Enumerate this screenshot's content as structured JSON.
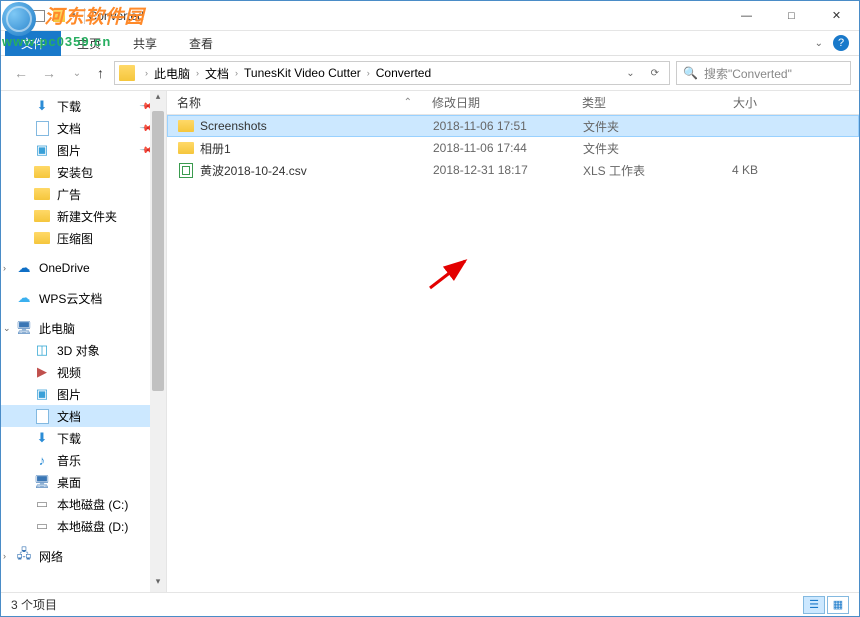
{
  "window": {
    "title": "Converted",
    "minimize": "—",
    "maximize": "□",
    "close": "✕"
  },
  "ribbon": {
    "file": "文件",
    "home": "主页",
    "share": "共享",
    "view": "查看",
    "expand_hint": "⌄"
  },
  "nav": {
    "back": "←",
    "forward": "→",
    "recent": "⌄",
    "up": "↑",
    "refresh": "⟳",
    "search_placeholder": "搜索\"Converted\""
  },
  "breadcrumb": {
    "root": "此电脑",
    "p1": "文档",
    "p2": "TunesKit Video Cutter",
    "p3": "Converted"
  },
  "columns": {
    "name": "名称",
    "date": "修改日期",
    "type": "类型",
    "size": "大小"
  },
  "files": [
    {
      "name": "Screenshots",
      "date": "2018-11-06 17:51",
      "type": "文件夹",
      "size": "",
      "kind": "folder",
      "selected": true
    },
    {
      "name": "相册1",
      "date": "2018-11-06 17:44",
      "type": "文件夹",
      "size": "",
      "kind": "folder",
      "selected": false
    },
    {
      "name": "黄波2018-10-24.csv",
      "date": "2018-12-31 18:17",
      "type": "XLS 工作表",
      "size": "4 KB",
      "kind": "xls",
      "selected": false
    }
  ],
  "sidebar": {
    "downloads": "下载",
    "documents": "文档",
    "pictures": "图片",
    "installers": "安装包",
    "ads": "广告",
    "newfolder": "新建文件夹",
    "archives": "压缩图",
    "onedrive": "OneDrive",
    "wpscloud": "WPS云文档",
    "thispc": "此电脑",
    "objects3d": "3D 对象",
    "videos": "视频",
    "pictures2": "图片",
    "documents2": "文档",
    "downloads2": "下载",
    "music": "音乐",
    "desktop": "桌面",
    "diskC": "本地磁盘 (C:)",
    "diskD": "本地磁盘 (D:)",
    "network": "网络"
  },
  "status": {
    "items": "3 个项目"
  },
  "watermark": {
    "text": "河东软件园",
    "url": "www.pc0359.cn"
  }
}
